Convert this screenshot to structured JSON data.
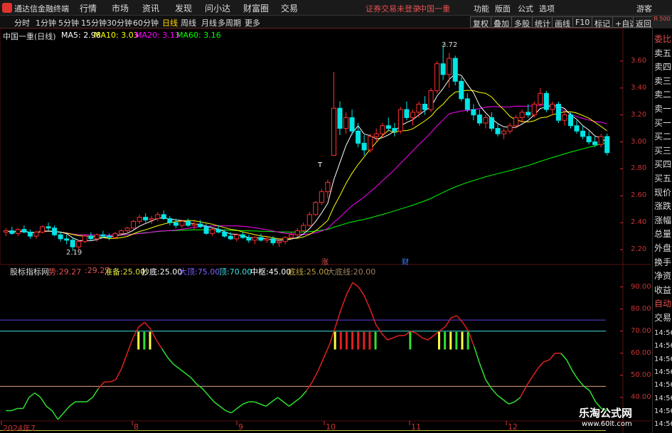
{
  "app": {
    "title": "通达信金融终端"
  },
  "top_menu": [
    "行情",
    "市场",
    "资讯",
    "发现",
    "问小达",
    "财富圈",
    "交易"
  ],
  "login_status": "证券交易未登录",
  "stock_name_top": "中国一重",
  "right_menu": [
    "功能",
    "版面",
    "公式",
    "选项"
  ],
  "guest_label": "游客",
  "r_badge": "R 500",
  "period_tabs": [
    "分时",
    "1分钟",
    "5分钟",
    "15分钟",
    "30分钟",
    "60分钟",
    "日线",
    "周线",
    "月线",
    "多周期",
    "更多"
  ],
  "active_period": "日线",
  "toolbar_buttons": [
    "复权",
    "叠加",
    "多股",
    "统计",
    "画线",
    "F10",
    "标记",
    "+自选",
    "返回"
  ],
  "main": {
    "stock_label": "中国一重(日线)",
    "ma": [
      {
        "name": "MA5",
        "value": "2.98",
        "color": "#ffffff"
      },
      {
        "name": "MA10",
        "value": "3.03",
        "color": "#ffff00"
      },
      {
        "name": "MA20",
        "value": "3.13",
        "color": "#ff00ff"
      },
      {
        "name": "MA60",
        "value": "3.16",
        "color": "#00ff00"
      }
    ],
    "price_labels": [
      "3.60",
      "3.40",
      "3.20",
      "3.00",
      "2.80",
      "2.60",
      "2.40",
      "2.20"
    ],
    "high_label": "3.72",
    "low_label": "2.19",
    "t_marker": "T",
    "event_tags": [
      {
        "text": "涨",
        "color": "#e05050"
      },
      {
        "text": "财",
        "color": "#4080ff"
      }
    ]
  },
  "indicator": {
    "name": "股标指标网",
    "params": [
      {
        "label": "势:",
        "value": "29.27",
        "color": "#e05050"
      },
      {
        "label": ":",
        "value": "29.27",
        "color": "#e05050"
      },
      {
        "label": "准备:",
        "value": "25.00",
        "color": "#e0e040"
      },
      {
        "label": "抄底:",
        "value": "25.00",
        "color": "#ffffff"
      },
      {
        "label": "大顶:",
        "value": "75.00",
        "color": "#8060ff"
      },
      {
        "label": "顶:",
        "value": "70.00",
        "color": "#40e0e0"
      },
      {
        "label": "中枢:",
        "value": "45.00",
        "color": "#ffffff"
      },
      {
        "label": "底线:",
        "value": "25.00",
        "color": "#c0a040"
      },
      {
        "label": "大底线:",
        "value": "20.00",
        "color": "#a08060"
      }
    ],
    "axis_labels": [
      "90.00",
      "80.00",
      "70.00",
      "60.00",
      "50.00",
      "40.00"
    ]
  },
  "dates": [
    "2024年7",
    "8",
    "9",
    "10",
    "11",
    "12"
  ],
  "side_panel": [
    "委比",
    "卖五",
    "卖四",
    "卖三",
    "卖二",
    "卖一",
    "买一",
    "买二",
    "买三",
    "买四",
    "买五",
    "现价",
    "涨跌",
    "涨幅",
    "总量",
    "外盘",
    "换手",
    "净资",
    "收益",
    "自动",
    "交易"
  ],
  "side_times": [
    "14:56",
    "14:56",
    "14:56",
    "14:56",
    "14:56",
    "14:56",
    "14:56",
    "14:56",
    "14:56",
    "14:56"
  ],
  "watermark": {
    "line1": "乐淘公式网",
    "line2": "www.60lt.com"
  },
  "chart_data": {
    "type": "candlestick",
    "price_range": [
      2.1,
      3.8
    ],
    "candles": [
      [
        2.33,
        2.36,
        2.3,
        2.34
      ],
      [
        2.34,
        2.37,
        2.31,
        2.32
      ],
      [
        2.32,
        2.36,
        2.3,
        2.35
      ],
      [
        2.35,
        2.38,
        2.32,
        2.33
      ],
      [
        2.33,
        2.35,
        2.28,
        2.3
      ],
      [
        2.3,
        2.34,
        2.28,
        2.33
      ],
      [
        2.33,
        2.38,
        2.32,
        2.37
      ],
      [
        2.37,
        2.4,
        2.34,
        2.36
      ],
      [
        2.36,
        2.38,
        2.3,
        2.31
      ],
      [
        2.31,
        2.33,
        2.26,
        2.28
      ],
      [
        2.28,
        2.31,
        2.24,
        2.27
      ],
      [
        2.27,
        2.29,
        2.19,
        2.22
      ],
      [
        2.22,
        2.27,
        2.2,
        2.26
      ],
      [
        2.26,
        2.31,
        2.25,
        2.3
      ],
      [
        2.3,
        2.33,
        2.27,
        2.28
      ],
      [
        2.28,
        2.32,
        2.26,
        2.31
      ],
      [
        2.31,
        2.34,
        2.29,
        2.3
      ],
      [
        2.3,
        2.32,
        2.27,
        2.29
      ],
      [
        2.29,
        2.33,
        2.28,
        2.32
      ],
      [
        2.32,
        2.35,
        2.3,
        2.34
      ],
      [
        2.34,
        2.37,
        2.32,
        2.36
      ],
      [
        2.36,
        2.42,
        2.35,
        2.41
      ],
      [
        2.41,
        2.46,
        2.39,
        2.44
      ],
      [
        2.44,
        2.47,
        2.4,
        2.42
      ],
      [
        2.42,
        2.45,
        2.39,
        2.43
      ],
      [
        2.43,
        2.48,
        2.41,
        2.46
      ],
      [
        2.46,
        2.49,
        2.42,
        2.43
      ],
      [
        2.43,
        2.45,
        2.38,
        2.4
      ],
      [
        2.4,
        2.43,
        2.36,
        2.38
      ],
      [
        2.38,
        2.42,
        2.36,
        2.41
      ],
      [
        2.41,
        2.43,
        2.37,
        2.38
      ],
      [
        2.38,
        2.41,
        2.35,
        2.39
      ],
      [
        2.39,
        2.42,
        2.36,
        2.37
      ],
      [
        2.37,
        2.39,
        2.31,
        2.32
      ],
      [
        2.32,
        2.36,
        2.3,
        2.35
      ],
      [
        2.35,
        2.38,
        2.32,
        2.33
      ],
      [
        2.33,
        2.35,
        2.29,
        2.3
      ],
      [
        2.3,
        2.33,
        2.27,
        2.28
      ],
      [
        2.28,
        2.32,
        2.26,
        2.31
      ],
      [
        2.31,
        2.33,
        2.28,
        2.29
      ],
      [
        2.29,
        2.31,
        2.25,
        2.27
      ],
      [
        2.27,
        2.3,
        2.24,
        2.29
      ],
      [
        2.29,
        2.32,
        2.26,
        2.27
      ],
      [
        2.27,
        2.3,
        2.25,
        2.28
      ],
      [
        2.28,
        2.3,
        2.23,
        2.25
      ],
      [
        2.25,
        2.28,
        2.22,
        2.26
      ],
      [
        2.26,
        2.3,
        2.24,
        2.29
      ],
      [
        2.29,
        2.33,
        2.27,
        2.31
      ],
      [
        2.31,
        2.36,
        2.29,
        2.34
      ],
      [
        2.34,
        2.4,
        2.33,
        2.38
      ],
      [
        2.38,
        2.48,
        2.37,
        2.46
      ],
      [
        2.46,
        2.56,
        2.45,
        2.55
      ],
      [
        2.55,
        2.65,
        2.53,
        2.63
      ],
      [
        2.63,
        2.72,
        2.58,
        2.7
      ],
      [
        2.9,
        3.52,
        2.95,
        3.25
      ],
      [
        3.25,
        3.3,
        3.05,
        3.1
      ],
      [
        3.1,
        3.22,
        3.06,
        3.18
      ],
      [
        3.18,
        3.24,
        3.05,
        3.08
      ],
      [
        3.08,
        3.14,
        2.96,
        2.99
      ],
      [
        2.99,
        3.05,
        2.9,
        2.94
      ],
      [
        2.94,
        3.06,
        2.92,
        3.04
      ],
      [
        3.04,
        3.1,
        3.0,
        3.06
      ],
      [
        3.06,
        3.14,
        3.03,
        3.12
      ],
      [
        3.12,
        3.18,
        3.08,
        3.1
      ],
      [
        3.1,
        3.14,
        3.04,
        3.08
      ],
      [
        3.08,
        3.26,
        3.06,
        3.24
      ],
      [
        3.24,
        3.3,
        3.16,
        3.18
      ],
      [
        3.18,
        3.24,
        3.12,
        3.22
      ],
      [
        3.22,
        3.3,
        3.18,
        3.28
      ],
      [
        3.28,
        3.34,
        3.2,
        3.24
      ],
      [
        3.24,
        3.4,
        3.22,
        3.38
      ],
      [
        3.38,
        3.6,
        3.36,
        3.58
      ],
      [
        3.58,
        3.72,
        3.46,
        3.5
      ],
      [
        3.5,
        3.66,
        3.4,
        3.62
      ],
      [
        3.62,
        3.64,
        3.42,
        3.45
      ],
      [
        3.45,
        3.48,
        3.3,
        3.32
      ],
      [
        3.32,
        3.36,
        3.22,
        3.24
      ],
      [
        3.24,
        3.28,
        3.16,
        3.2
      ],
      [
        3.2,
        3.24,
        3.12,
        3.14
      ],
      [
        3.14,
        3.2,
        3.1,
        3.18
      ],
      [
        3.18,
        3.22,
        3.08,
        3.1
      ],
      [
        3.1,
        3.14,
        3.04,
        3.06
      ],
      [
        3.06,
        3.1,
        3.02,
        3.08
      ],
      [
        3.08,
        3.14,
        3.06,
        3.12
      ],
      [
        3.12,
        3.2,
        3.1,
        3.18
      ],
      [
        3.18,
        3.24,
        3.14,
        3.22
      ],
      [
        3.22,
        3.28,
        3.18,
        3.2
      ],
      [
        3.2,
        3.3,
        3.18,
        3.28
      ],
      [
        3.28,
        3.4,
        3.26,
        3.36
      ],
      [
        3.36,
        3.38,
        3.22,
        3.24
      ],
      [
        3.24,
        3.3,
        3.2,
        3.28
      ],
      [
        3.28,
        3.3,
        3.14,
        3.16
      ],
      [
        3.16,
        3.22,
        3.12,
        3.2
      ],
      [
        3.2,
        3.22,
        3.1,
        3.12
      ],
      [
        3.12,
        3.16,
        3.06,
        3.08
      ],
      [
        3.08,
        3.12,
        3.02,
        3.04
      ],
      [
        3.04,
        3.08,
        2.98,
        3.0
      ],
      [
        3.0,
        3.04,
        2.96,
        2.98
      ],
      [
        2.98,
        3.06,
        2.96,
        3.04
      ],
      [
        3.04,
        3.06,
        2.9,
        2.92
      ]
    ],
    "indicator_range": [
      30,
      95
    ],
    "indicator_levels": [
      75,
      70,
      45,
      25,
      20
    ],
    "indicator_series": [
      34,
      34,
      35,
      35,
      40,
      42,
      40,
      36,
      34,
      30,
      33,
      36,
      38,
      38,
      38,
      40,
      44,
      47,
      47,
      48,
      53,
      60,
      67,
      72,
      74,
      71,
      66,
      62,
      58,
      55,
      53,
      51,
      49,
      46,
      44,
      41,
      38,
      36,
      34,
      33,
      35,
      37,
      38,
      38,
      37,
      36,
      38,
      40,
      38,
      36,
      38,
      40,
      43,
      47,
      52,
      58,
      64,
      72,
      80,
      87,
      92,
      90,
      86,
      80,
      73,
      69,
      66,
      67,
      68,
      68,
      70,
      69,
      67,
      66,
      68,
      70,
      72,
      76,
      77,
      74,
      70,
      63,
      55,
      48,
      44,
      41,
      39,
      37,
      38,
      40,
      45,
      49,
      53,
      56,
      57,
      60,
      60,
      57,
      52,
      48,
      45,
      43,
      38,
      35,
      34
    ]
  }
}
